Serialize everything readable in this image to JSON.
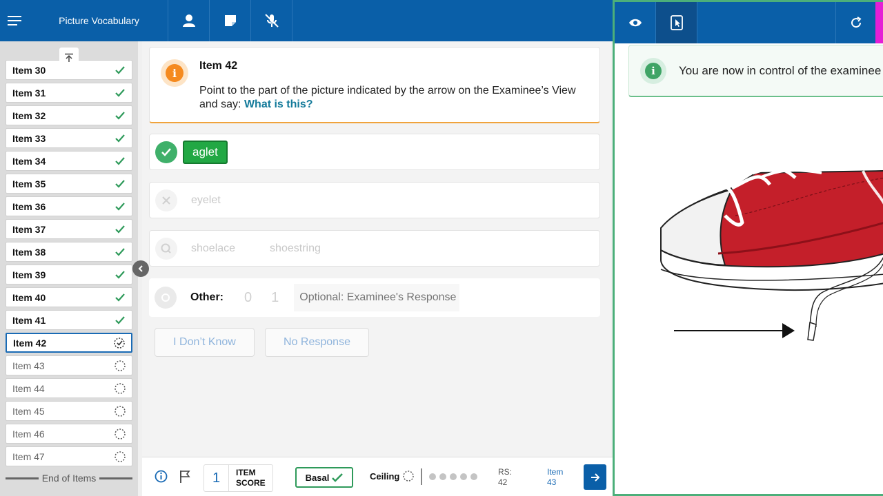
{
  "header": {
    "title": "Picture Vocabulary",
    "icons": [
      "menu-icon",
      "person-icon",
      "note-icon",
      "mic-off-icon"
    ]
  },
  "sidebar": {
    "items": [
      {
        "label": "Item 30",
        "status": "done"
      },
      {
        "label": "Item 31",
        "status": "done"
      },
      {
        "label": "Item 32",
        "status": "done"
      },
      {
        "label": "Item 33",
        "status": "done"
      },
      {
        "label": "Item 34",
        "status": "done"
      },
      {
        "label": "Item 35",
        "status": "done"
      },
      {
        "label": "Item 36",
        "status": "done"
      },
      {
        "label": "Item 37",
        "status": "done"
      },
      {
        "label": "Item 38",
        "status": "done"
      },
      {
        "label": "Item 39",
        "status": "done"
      },
      {
        "label": "Item 40",
        "status": "done"
      },
      {
        "label": "Item 41",
        "status": "done"
      },
      {
        "label": "Item 42",
        "status": "current"
      },
      {
        "label": "Item 43",
        "status": "pending"
      },
      {
        "label": "Item 44",
        "status": "pending"
      },
      {
        "label": "Item 45",
        "status": "pending"
      },
      {
        "label": "Item 46",
        "status": "pending"
      },
      {
        "label": "Item 47",
        "status": "pending"
      }
    ],
    "end_label": "End of Items"
  },
  "item": {
    "title": "Item 42",
    "prompt_prefix": "Point to the part of the picture indicated by the arrow on the Examinee’s View and say: ",
    "prompt_question": "What is this?"
  },
  "answers": {
    "correct": "aglet",
    "incorrect": "eyelet",
    "alt_1": "shoelace",
    "alt_2": "shoestring",
    "other_label": "Other:",
    "score_0": "0",
    "score_1": "1",
    "response_placeholder": "Optional: Examinee's Response"
  },
  "actions": {
    "dont_know": "I Don’t Know",
    "no_response": "No Response"
  },
  "footer": {
    "item_score_value": "1",
    "item_score_line1": "ITEM",
    "item_score_line2": "SCORE",
    "basal": "Basal",
    "ceiling": "Ceiling",
    "ceiling_dots": 5,
    "rs_label": "RS:",
    "rs_value": "42",
    "next_label": "Item",
    "next_value": "43"
  },
  "examinee_panel": {
    "icons": [
      "eye-icon",
      "tablet-pointer-icon",
      "refresh-icon"
    ],
    "banner_text": "You are now in control of the examinee",
    "accent_color": "#e41fd6"
  },
  "colors": {
    "primary": "#0a5fa8",
    "success": "#3fb06a",
    "warning": "#f58a1f",
    "correct_chip": "#22a844"
  }
}
